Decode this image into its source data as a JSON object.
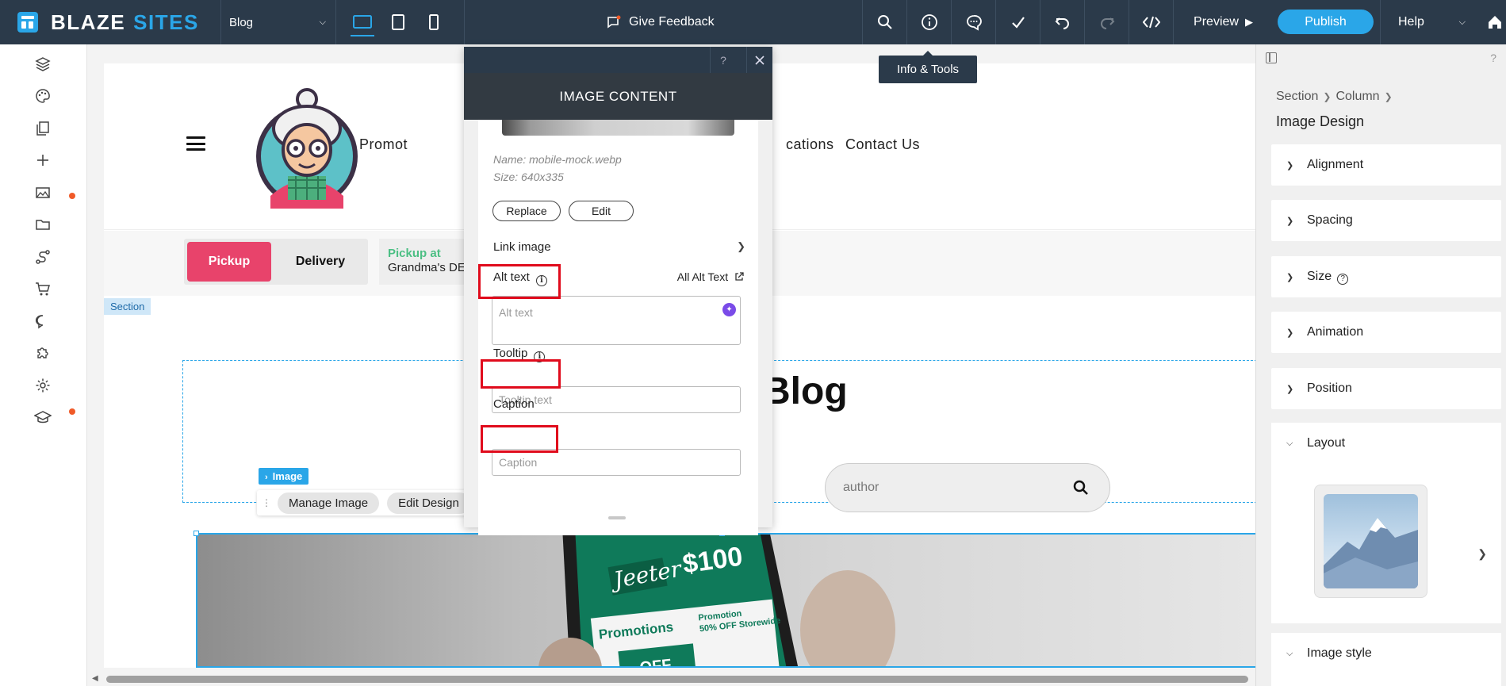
{
  "app": {
    "logo_part1": "BLAZE",
    "logo_part2": "SITES",
    "page_selector": "Blog",
    "feedback_label": "Give Feedback",
    "preview_label": "Preview",
    "publish_label": "Publish",
    "help_label": "Help",
    "tooltip": "Info & Tools"
  },
  "site": {
    "nav": [
      "Promotions",
      "Locations",
      "Contact Us"
    ],
    "nav_visible": [
      "Promot",
      "cations",
      "Contact Us"
    ],
    "pickup_label": "Pickup",
    "delivery_label": "Delivery",
    "pickup_at_label": "Pickup at",
    "pickup_at_location": "Grandma's DE",
    "section_tag": "Section",
    "blog_title": "Blog",
    "search_placeholder": "author",
    "image_tag": "Image",
    "manage_image": "Manage Image",
    "edit_design": "Edit Design"
  },
  "dialog": {
    "help": "?",
    "title": "IMAGE CONTENT",
    "name_meta": "Name: mobile-mock.webp",
    "size_meta": "Size: 640x335",
    "replace_label": "Replace",
    "edit_label": "Edit",
    "link_image_label": "Link image",
    "alt_text_label": "Alt text",
    "all_alt_text_label": "All Alt Text",
    "alt_text_placeholder": "Alt text",
    "tooltip_label": "Tooltip",
    "tooltip_placeholder": "Tooltip text",
    "caption_label": "Caption",
    "caption_placeholder": "Caption"
  },
  "panel": {
    "help": "?",
    "breadcrumb": [
      "Section",
      "Column"
    ],
    "title": "Image Design",
    "sections": [
      "Alignment",
      "Spacing",
      "Size",
      "Animation",
      "Position"
    ],
    "layout_label": "Layout",
    "image_style_label": "Image style"
  },
  "colors": {
    "topbar": "#2b3a4a",
    "accent": "#2aa6e8",
    "pickup": "#e8436b",
    "highlight": "#e00b1c",
    "notification": "#f05a28"
  }
}
